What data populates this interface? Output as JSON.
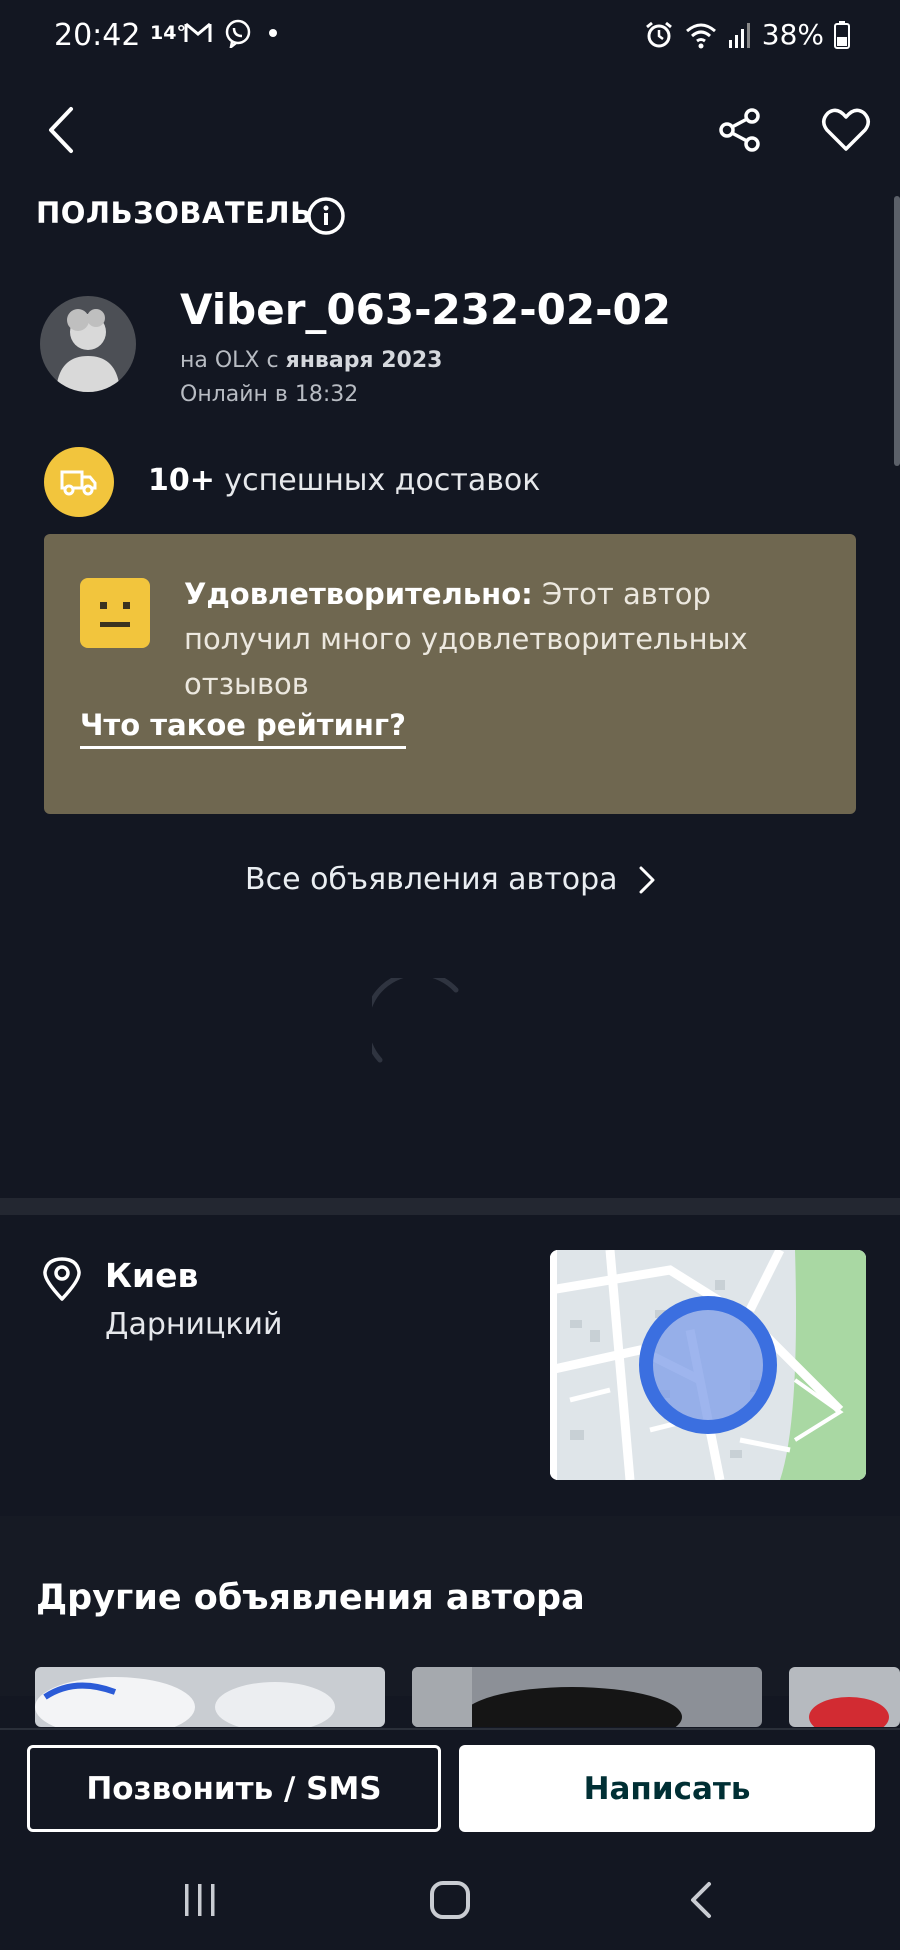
{
  "status_bar": {
    "time": "20:42",
    "temperature": "14°",
    "battery": "38%",
    "icons": [
      "gmail-icon",
      "viber-icon",
      "dot-icon",
      "alarm-icon",
      "wifi-icon",
      "signal-icon",
      "battery-icon"
    ]
  },
  "header": {
    "back_icon": "back-arrow-icon",
    "share_icon": "share-icon",
    "favorite_icon": "heart-icon"
  },
  "user_section": {
    "label": "ПОЛЬЗОВАТЕЛЬ",
    "info_icon": "info-icon",
    "username": "Viber_063-232-02-02",
    "member_prefix": "на OLX с ",
    "member_since": "января 2023",
    "online": "Онлайн в 18:32"
  },
  "delivery": {
    "count": "10+",
    "text": " успешных доставок"
  },
  "rating": {
    "title": "Удовлетворительно:",
    "description": " Этот автор получил много удовлетворительных отзывов",
    "link": "Что такое рейтинг?"
  },
  "all_ads": {
    "label": "Все объявления автора"
  },
  "location": {
    "city": "Киев",
    "district": "Дарницкий"
  },
  "other_ads": {
    "title": "Другие объявления автора"
  },
  "actions": {
    "call": "Позвонить / SMS",
    "write": "Написать"
  },
  "colors": {
    "background": "#131722",
    "accent_yellow": "#f2c53d",
    "rating_card": "#6f6750",
    "map_circle": "#3b6fe0"
  }
}
